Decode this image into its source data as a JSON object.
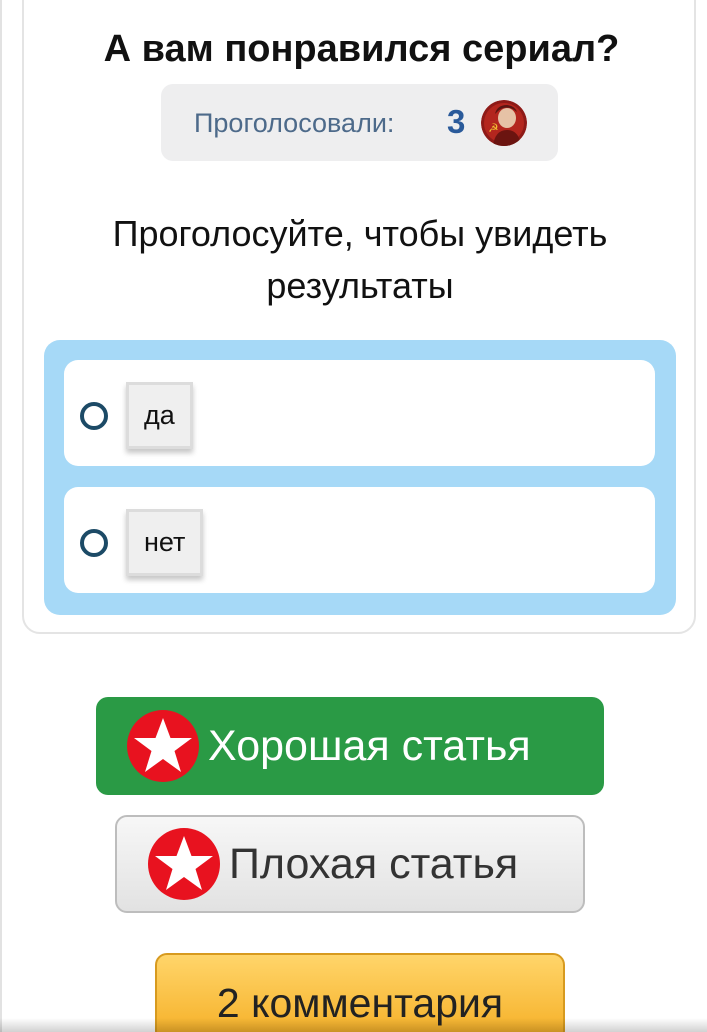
{
  "poll": {
    "title": "А вам понравился сериал?",
    "voters_label": "Проголосовали:",
    "voters_count": "3",
    "prompt_line1": "Проголосуйте, чтобы увидеть",
    "prompt_line2": "результаты",
    "options": [
      {
        "label": "да"
      },
      {
        "label": "нет"
      }
    ]
  },
  "rating": {
    "good_label": "Хорошая статья",
    "bad_label": "Плохая статья",
    "icon": "red-star-icon",
    "colors": {
      "good": "#2a9a45",
      "bad": "#e6e6e6",
      "star_circle": "#e8121f"
    }
  },
  "comments": {
    "button_label": "2 комментария",
    "color": "#f8b93a"
  },
  "colors": {
    "options_bg": "#a6d9f7",
    "radio": "#1c4a66",
    "voters_count": "#2a5a9a"
  }
}
